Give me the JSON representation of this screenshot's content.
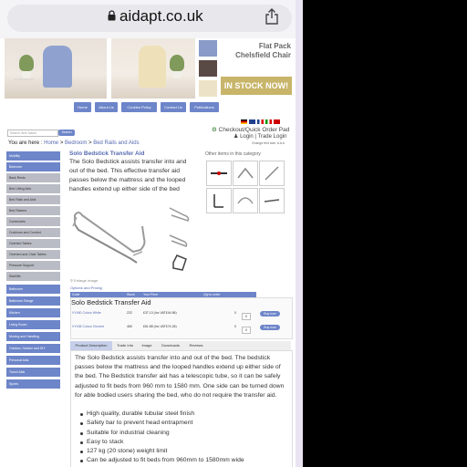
{
  "browser": {
    "url": "aidapt.co.uk"
  },
  "banner": {
    "flat_pack_title": "Flat Pack\nChelsfield Chair",
    "in_stock": "IN STOCK NOW!",
    "swatch_colors": [
      "#8a9bc9",
      "#5a4a45",
      "#ece2c7"
    ]
  },
  "nav": {
    "items": [
      "Home",
      "About Us",
      "Cookies Policy",
      "Contact Us",
      "Publications"
    ]
  },
  "search": {
    "placeholder": "Search Item Name",
    "button": "Search"
  },
  "header": {
    "checkout": "Checkout/Quick Order Pad",
    "login": "Login | Trade Login",
    "text_size": "Change text size: A A A"
  },
  "breadcrumb": {
    "prefix": "You are here : ",
    "home": "Home",
    "sep": " > ",
    "category": "Bedroom",
    "current": "Bed Rails and Aids"
  },
  "sidebar": {
    "items": [
      "Mobility",
      "Bedroom",
      "Back Rests",
      "Bed Lifting Aids",
      "Bed Rails and Aids",
      "Bed Raisers",
      "Commodes",
      "Cushions and Comfort",
      "Overbed Tables",
      "Overbed and Chair Tables",
      "Pressure Support",
      "Stairlifts",
      "Bathroom",
      "Bathroom Range",
      "Kitchen",
      "Living Room",
      "Moving and Handling",
      "Outdoor, Garden and DIY",
      "Personal Aids",
      "Travel Aids",
      "Sports"
    ]
  },
  "product": {
    "title": "Solo Bedstick Transfer Aid",
    "short_desc": "The Solo Bedstick assists transfer into and out of the bed. This effective transfer aid passes below the mattress and the looped handles extend up either side of the bed",
    "other_items_title": "Other items in this category",
    "enlarge": "Enlarge Image",
    "options_title": "Options and Pricing",
    "option_headers": [
      "Code",
      "Stock",
      "Your Price",
      "Qty to order"
    ],
    "sticky_title": "Solo Bedstick Transfer Aid",
    "options": [
      {
        "code": "VY460 Colour White",
        "stock": "222",
        "price": "£37.13 (Inc VAT£44.56)",
        "qty": "0",
        "buy": "Buy now"
      },
      {
        "code": "VY436 Colour Chrome",
        "stock": "460",
        "price": "£61.88 (Inc VAT£74.26)",
        "qty": "0",
        "buy": "Buy now"
      }
    ]
  },
  "tabs": [
    "Product Description",
    "Trade Info",
    "Image",
    "Downloads",
    "Reviews"
  ],
  "description": {
    "paragraph": "The Solo Bedstick assists transfer into and out of the bed. The bedstick passes below the mattress and the looped handles extend up either side of the bed. The Bedstick transfer aid has a telescopic tube, so it can be safely adjusted to fit beds from 960 mm to 1580 mm. One side can be turned down for able bodied users sharing the bed, who do not require the transfer aid.",
    "bullets": [
      "High quality, durable tubular steel finish",
      "Safety bar to prevent head entrapment",
      "Suitable for industrial cleaning",
      "Easy to stack",
      "127 kg (20 stone) weight limit",
      "Can be adjusted to fit beds from 960mm to 1580mm wide"
    ]
  }
}
